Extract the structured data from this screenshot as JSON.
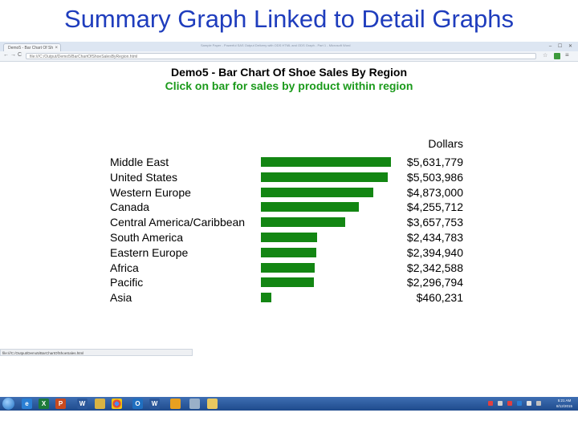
{
  "slide": {
    "title": "Summary Graph Linked to Detail Graphs"
  },
  "browser": {
    "tab_label": "Demo5 - Bar Chart Of Sh",
    "tab_close": "×",
    "window_title": "Sample Paper - Powerful SAS Output Delivery with ODS HTML and ODS Graph - Part 1 - Microsoft Word",
    "window_controls": "– ☐ ✕",
    "back_icon": "←",
    "forward_icon": "→",
    "reload_icon": "C",
    "address": "file:///C:/Output/Demo5/BarChartOfShoeSalesByRegion.html",
    "star_icon": "☆",
    "menu_icon": "≡",
    "status_text": "file:///C:/Output/Demo5/BarChartOfShoeSales.html"
  },
  "chart_data": {
    "type": "bar",
    "orientation": "horizontal",
    "title": "Demo5 - Bar Chart Of Shoe Sales By Region",
    "subtitle": "Click on bar for sales by product within region",
    "value_header": "Dollars",
    "categories": [
      "Middle East",
      "United States",
      "Western Europe",
      "Canada",
      "Central America/Caribbean",
      "South America",
      "Eastern Europe",
      "Africa",
      "Pacific",
      "Asia"
    ],
    "values": [
      5631779,
      5503986,
      4873000,
      4255712,
      3657753,
      2434783,
      2394940,
      2342588,
      2296794,
      460231
    ],
    "value_labels": [
      "$5,631,779",
      "$5,503,986",
      "$4,873,000",
      "$4,255,712",
      "$3,657,753",
      "$2,434,783",
      "$2,394,940",
      "$2,342,588",
      "$2,296,794",
      "$460,231"
    ],
    "bar_color": "#138613",
    "title_color": "#000000",
    "subtitle_color": "#1b9a1b"
  },
  "taskbar": {
    "icons": [
      "start",
      "internet-explorer",
      "excel",
      "powerpoint",
      "word",
      "windows-explorer",
      "chrome",
      "outlook",
      "word",
      "paint",
      "sas",
      "folder"
    ],
    "clock_time": "5:21 AM",
    "clock_date": "8/12/2015"
  }
}
